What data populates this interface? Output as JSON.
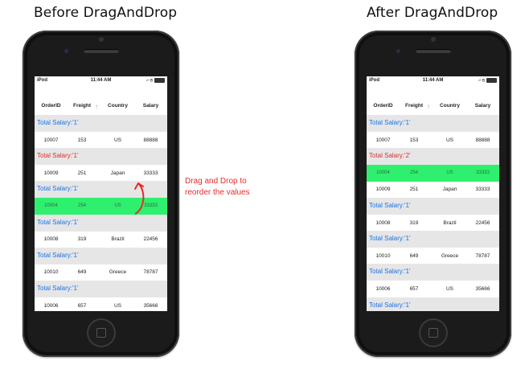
{
  "titles": {
    "before": "Before DragAndDrop",
    "after": "After DragAndDrop"
  },
  "annotation": {
    "text": "Drag and Drop to reorder the values",
    "color": "#e52b2b"
  },
  "colors": {
    "group_label": "#1a73e8",
    "group_label_highlight": "#e52b2b",
    "dragged_row": "#2ef06e",
    "group_band": "#e6e6e6",
    "phone_body": "#1b1b1b"
  },
  "status_bar": {
    "carrier": "iPod",
    "time": "11:44 AM"
  },
  "columns": [
    "OrderID",
    "Freight",
    "Country",
    "Salary"
  ],
  "before": {
    "rows": [
      {
        "type": "group",
        "label": "Total Salary:'1'",
        "highlight": false
      },
      {
        "type": "data",
        "cells": [
          "10007",
          "153",
          "US",
          "88888"
        ],
        "dragged": false
      },
      {
        "type": "group",
        "label": "Total Salary:'1'",
        "highlight": true
      },
      {
        "type": "data",
        "cells": [
          "10009",
          "251",
          "Japan",
          "33333"
        ],
        "dragged": false
      },
      {
        "type": "group",
        "label": "Total Salary:'1'",
        "highlight": false
      },
      {
        "type": "data",
        "cells": [
          "10004",
          "254",
          "US",
          "33333"
        ],
        "dragged": true
      },
      {
        "type": "group",
        "label": "Total Salary:'1'",
        "highlight": false
      },
      {
        "type": "data",
        "cells": [
          "10008",
          "319",
          "Brazil",
          "22456"
        ],
        "dragged": false
      },
      {
        "type": "group",
        "label": "Total Salary:'1'",
        "highlight": false
      },
      {
        "type": "data",
        "cells": [
          "10010",
          "649",
          "Greece",
          "78787"
        ],
        "dragged": false
      },
      {
        "type": "group",
        "label": "Total Salary:'1'",
        "highlight": false
      },
      {
        "type": "data",
        "cells": [
          "10006",
          "657",
          "US",
          "35666"
        ],
        "dragged": false
      }
    ]
  },
  "after": {
    "rows": [
      {
        "type": "group",
        "label": "Total Salary:'1'",
        "highlight": false
      },
      {
        "type": "data",
        "cells": [
          "10007",
          "153",
          "US",
          "88888"
        ],
        "dragged": false
      },
      {
        "type": "group",
        "label": "Total Salary:'2'",
        "highlight": true
      },
      {
        "type": "data",
        "cells": [
          "10004",
          "254",
          "US",
          "33333"
        ],
        "dragged": true
      },
      {
        "type": "data",
        "cells": [
          "10009",
          "251",
          "Japan",
          "33333"
        ],
        "dragged": false
      },
      {
        "type": "group",
        "label": "Total Salary:'1'",
        "highlight": false
      },
      {
        "type": "data",
        "cells": [
          "10008",
          "319",
          "Brazil",
          "22456"
        ],
        "dragged": false
      },
      {
        "type": "group",
        "label": "Total Salary:'1'",
        "highlight": false
      },
      {
        "type": "data",
        "cells": [
          "10010",
          "649",
          "Greece",
          "78787"
        ],
        "dragged": false
      },
      {
        "type": "group",
        "label": "Total Salary:'1'",
        "highlight": false
      },
      {
        "type": "data",
        "cells": [
          "10006",
          "657",
          "US",
          "35666"
        ],
        "dragged": false
      },
      {
        "type": "group",
        "label": "Total Salary:'1'",
        "highlight": false
      }
    ]
  }
}
